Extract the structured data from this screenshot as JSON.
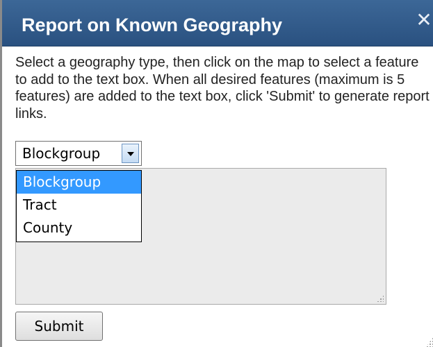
{
  "dialog": {
    "title": "Report on Known Geography",
    "close_label": "✕",
    "instructions": "Select a geography type, then click on the map to select a feature to add to the text box. When all desired features (maximum is 5 features) are added to the text box, click 'Submit' to generate report links."
  },
  "geography_select": {
    "value": "Blockgroup",
    "options": [
      {
        "label": "Blockgroup",
        "selected": true
      },
      {
        "label": "Tract",
        "selected": false
      },
      {
        "label": "County",
        "selected": false
      }
    ]
  },
  "features_textbox": {
    "value": ""
  },
  "submit": {
    "label": "Submit"
  },
  "colors": {
    "titlebar": "#2f5a8a",
    "selected_option": "#3399ff",
    "textbox_bg": "#ebebeb"
  },
  "icons": {
    "close": "close-icon",
    "dropdown_arrow": "chevron-down-icon"
  }
}
